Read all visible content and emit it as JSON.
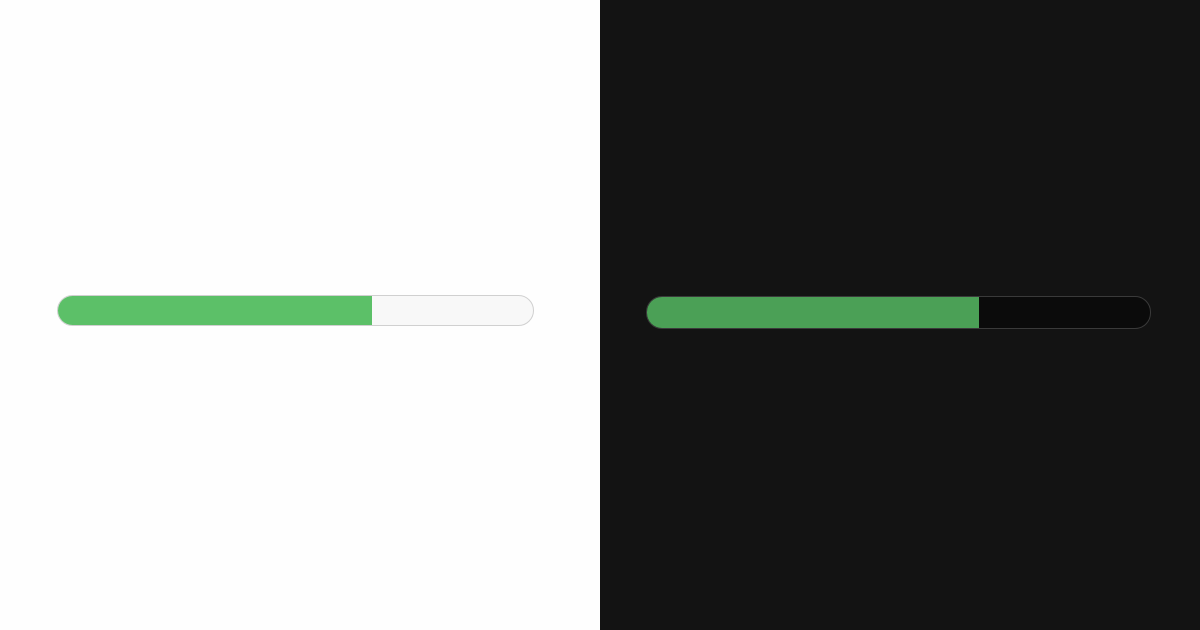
{
  "light_theme": {
    "progress_bar": {
      "value": 0.66,
      "fill_color": "#5cc068",
      "track_color": "#f8f8f8",
      "border_color": "#d0d0d0"
    },
    "background_color": "#fefefe"
  },
  "dark_theme": {
    "progress_bar": {
      "value": 0.66,
      "fill_color": "#4ba056",
      "track_color": "#0b0b0b",
      "border_color": "#3a3a3a"
    },
    "background_color": "#131313"
  }
}
